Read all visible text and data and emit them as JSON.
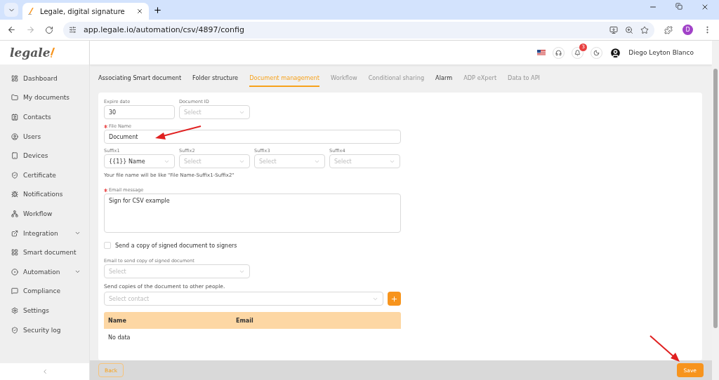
{
  "browser": {
    "tab_title": "Legale, digital signature",
    "url": "app.legale.io/automation/csv/4897/config",
    "profile_initial": "D"
  },
  "logo": {
    "text": "legale"
  },
  "sidebar": {
    "items": [
      {
        "label": "Dashboard",
        "selected": false,
        "expandable": false
      },
      {
        "label": "My documents",
        "selected": false,
        "expandable": false
      },
      {
        "label": "Contacts",
        "selected": false,
        "expandable": false
      },
      {
        "label": "Users",
        "selected": false,
        "expandable": false
      },
      {
        "label": "Devices",
        "selected": false,
        "expandable": false
      },
      {
        "label": "Certificate",
        "selected": false,
        "expandable": false
      },
      {
        "label": "Notifications",
        "selected": false,
        "expandable": false
      },
      {
        "label": "Workflow",
        "selected": false,
        "expandable": false
      },
      {
        "label": "Integration",
        "selected": false,
        "expandable": true
      },
      {
        "label": "Smart document",
        "selected": false,
        "expandable": false
      },
      {
        "label": "Automation",
        "selected": false,
        "expandable": true
      },
      {
        "label": "Compliance",
        "selected": false,
        "expandable": false
      },
      {
        "label": "Settings",
        "selected": false,
        "expandable": false
      },
      {
        "label": "Security log",
        "selected": false,
        "expandable": false
      }
    ]
  },
  "header": {
    "notification_count": "3",
    "user_name": "Diego Leyton Blanco"
  },
  "tabs": [
    {
      "label": "Associating Smart document",
      "selected": false,
      "disabled": false
    },
    {
      "label": "Folder structure",
      "selected": false,
      "disabled": false
    },
    {
      "label": "Document management",
      "selected": true,
      "disabled": false
    },
    {
      "label": "Workflow",
      "selected": false,
      "disabled": true
    },
    {
      "label": "Conditional sharing",
      "selected": false,
      "disabled": true
    },
    {
      "label": "Alarm",
      "selected": false,
      "disabled": false
    },
    {
      "label": "ADP eXpert",
      "selected": false,
      "disabled": true
    },
    {
      "label": "Data to API",
      "selected": false,
      "disabled": true
    }
  ],
  "form": {
    "expire_date": {
      "label": "Expire date",
      "value": "30"
    },
    "document_id": {
      "label": "Document ID",
      "placeholder": "Select"
    },
    "file_name": {
      "label": "File Name",
      "required": true,
      "value": "Document"
    },
    "suffixes": [
      {
        "label": "Suffix1",
        "value": "{{1}} Name"
      },
      {
        "label": "Suffix2",
        "placeholder": "Select"
      },
      {
        "label": "Suffix3",
        "placeholder": "Select"
      },
      {
        "label": "Suffix4",
        "placeholder": "Select"
      }
    ],
    "hint": "Your file name will be like \"File Name-Suffix1-Suffix2\"",
    "email_message": {
      "label": "Email message",
      "required": true,
      "value": "Sign for CSV example"
    },
    "copy_to_signers": {
      "label": "Send a copy of signed document to signers",
      "checked": false
    },
    "copy_email": {
      "label": "Email to send copy of signed document",
      "placeholder": "Select"
    },
    "other_people": {
      "label": "Send copies of the document to other people.",
      "placeholder": "Select contact"
    },
    "table": {
      "columns": [
        "Name",
        "Email"
      ],
      "empty": "No data"
    }
  },
  "footer": {
    "back": "Back",
    "save": "Save"
  }
}
